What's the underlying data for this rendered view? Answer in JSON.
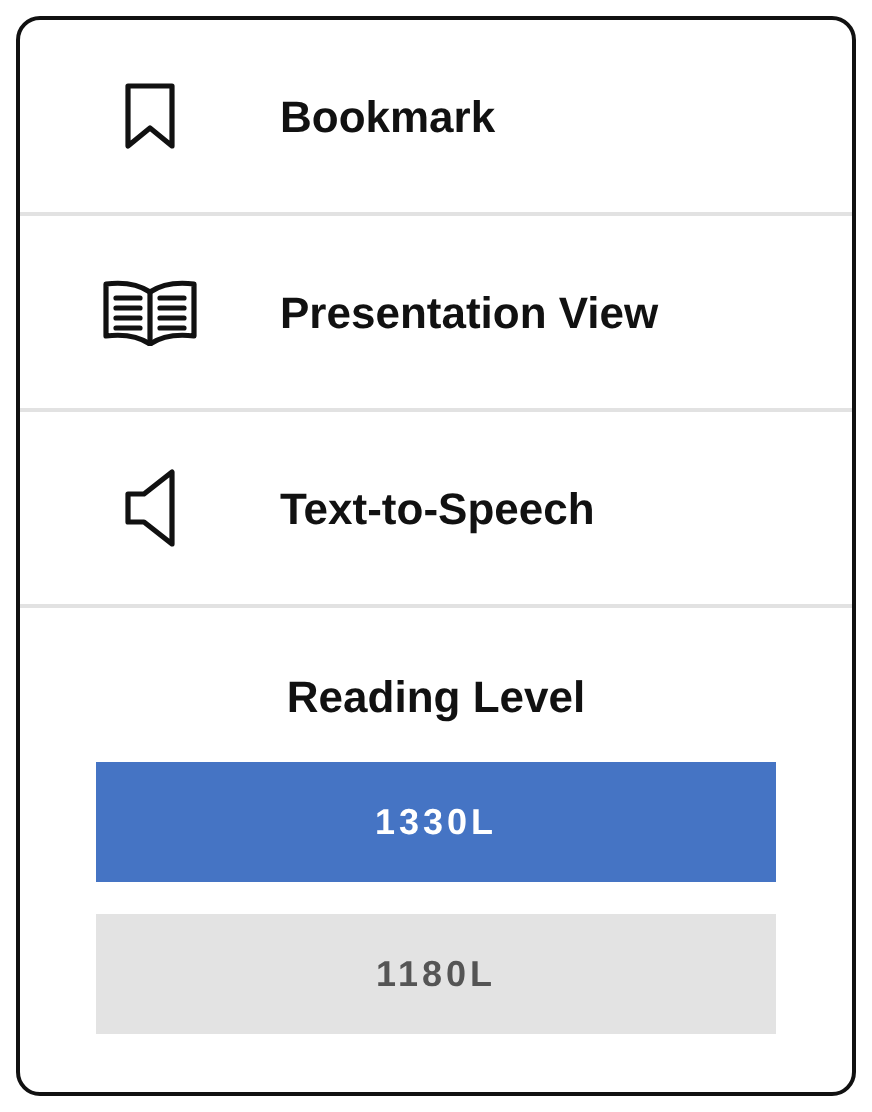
{
  "menu_items": [
    {
      "kind": "bookmark",
      "label": "Bookmark"
    },
    {
      "kind": "book",
      "label": "Presentation View"
    },
    {
      "kind": "speaker",
      "label": "Text-to-Speech"
    }
  ],
  "reading_level": {
    "title": "Reading Level",
    "options": [
      {
        "label": "1330L",
        "selected": true
      },
      {
        "label": "1180L",
        "selected": false
      }
    ]
  }
}
